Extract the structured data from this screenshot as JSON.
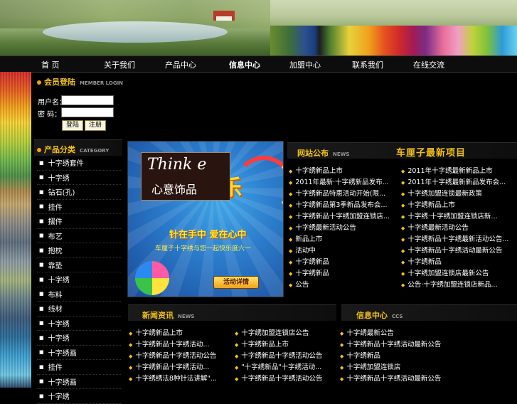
{
  "nav": {
    "items": [
      "首 页",
      "关于我们",
      "产品中心",
      "信息中心",
      "加盟中心",
      "联系我们",
      "在线交流"
    ]
  },
  "login": {
    "title": "会员登陆",
    "title_en": "MEMBER LOGIN",
    "username_label": "用户名：",
    "password_label": "密 码：",
    "login_button": "登陆",
    "register_button": "注册"
  },
  "category": {
    "title": "产品分类",
    "title_en": "CATEGORY",
    "items": [
      "十字绣套件",
      "十字绣",
      "钻石(孔)",
      "挂件",
      "摆件",
      "布艺",
      "抱枕",
      "靠垫",
      "十字绣",
      "布料",
      "线材",
      "十字绣",
      "十字绣",
      "十字绣画",
      "挂件",
      "十字绣画",
      "十字绣"
    ]
  },
  "promo": {
    "logo_en": "Think e",
    "logo_cn": "心意饰品",
    "headline": "快乐",
    "slogan": "针在手中 爱在心中",
    "subtitle": "车厘子十字绣与您一起快乐度六一",
    "cta": "活动详情"
  },
  "notice": {
    "title": "网站公布",
    "title_en": "NEWS",
    "side_title": "车厘子最新项目",
    "left": [
      "十字绣新品上市",
      "2011年最新·十字绣新品发布...",
      "十字绣新品特惠活动开始(限...",
      "十字绣新品第3季新品发布会...",
      "十字绣新品十字绣加盟连锁店...",
      "十字绣最新活动公告",
      "新品上市",
      "活动中",
      "十字绣新品",
      "十字绣新品",
      "公告"
    ],
    "right": [
      "2011年十字绣最新新品上市",
      "2011年十字绣最新新品发布会...",
      "十字绣加盟连锁最新政策",
      "十字绣新品上市",
      "十字绣·十字绣加盟连锁店新...",
      "十字绣最新活动公告",
      "十字绣新品十字绣最新活动公告...",
      "十字绣新品十字绣活动最新公告",
      "十字绣新品",
      "十字绣加盟连锁店最新公告",
      "公告·十字绣加盟连锁店新品..."
    ]
  },
  "news": {
    "title": "新闻资讯",
    "title_en": "NEWS",
    "col1": [
      "十字绣新品上市",
      "十字绣新品十字绣活动...",
      "十字绣新品十字绣活动公告",
      "十字绣新品十字绣活动...",
      "十字绣绣法8种针法讲解\"..."
    ],
    "col2": [
      "十字绣加盟连锁店公告",
      "十字绣新品上市",
      "十字绣新品十字绣活动公告",
      "\"十字绣新品\"十字绣活动...",
      "十字绣新品十字绣活动公告"
    ]
  },
  "info": {
    "title": "信息中心",
    "title_en": "CCS",
    "items": [
      "十字绣最新公告",
      "十字绣新品十字绣活动最新公告",
      "十字绣新品",
      "十字绣加盟连锁店",
      "十字绣新品十字绣活动最新公告"
    ]
  },
  "colors": {
    "accent_gold": "#f3c21b",
    "bullet_orange": "#f3a018",
    "background": "#000000"
  }
}
